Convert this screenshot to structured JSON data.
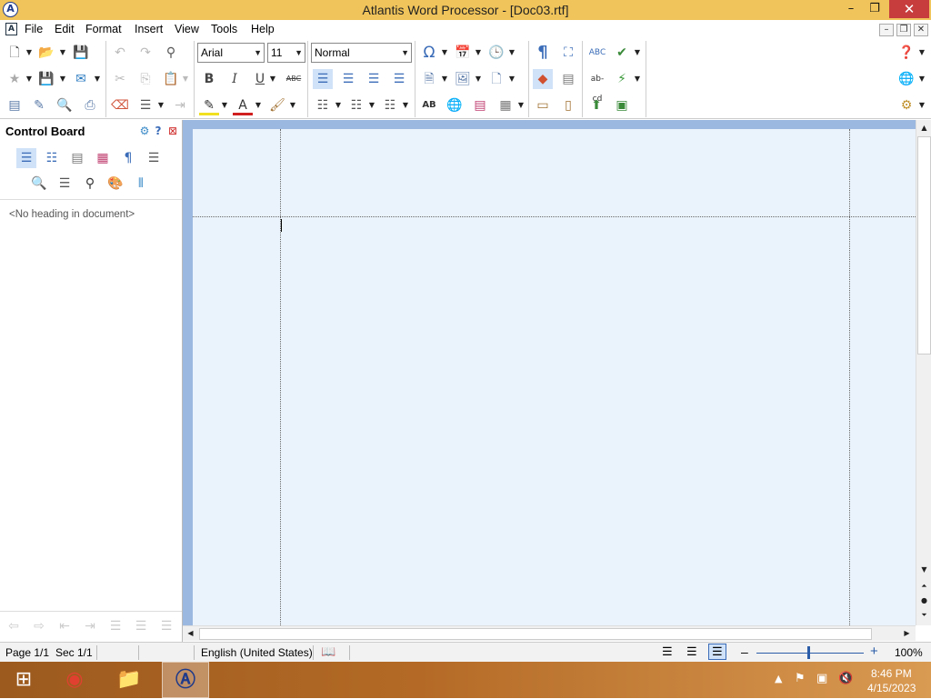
{
  "window": {
    "title": "Atlantis Word Processor - [Doc03.rtf]",
    "min": "–",
    "max": "❐",
    "close": "✕",
    "logo": "A"
  },
  "menu": {
    "items": [
      "File",
      "Edit",
      "Format",
      "Insert",
      "View",
      "Tools",
      "Help"
    ],
    "doc_icon": "A",
    "mdi_min": "–",
    "mdi_restore": "❐",
    "mdi_close": "✕"
  },
  "toolbar": {
    "font": "Arial",
    "size": "11",
    "style": "Normal",
    "bold": "B",
    "italic": "I",
    "underline": "U",
    "strike": "ABC",
    "font_color": "A",
    "superscript": "AB",
    "spell": "ABC",
    "abcd": "ab-cd",
    "omega": "Ω",
    "pilcrow": "¶"
  },
  "sidebar": {
    "title": "Control Board",
    "empty_text": "<No heading in document>"
  },
  "statusbar": {
    "page": "Page 1/1",
    "section": "Sec 1/1",
    "language": "English (United States)",
    "zoom_minus": "–",
    "zoom_plus": "+",
    "zoom": "100%"
  },
  "taskbar": {
    "time": "8:46 PM",
    "date": "4/15/2023"
  },
  "colors": {
    "titlebar": "#f0c45a",
    "close": "#c73c3c",
    "page": "#eaf3fb",
    "workspace": "#9bb8e0"
  }
}
